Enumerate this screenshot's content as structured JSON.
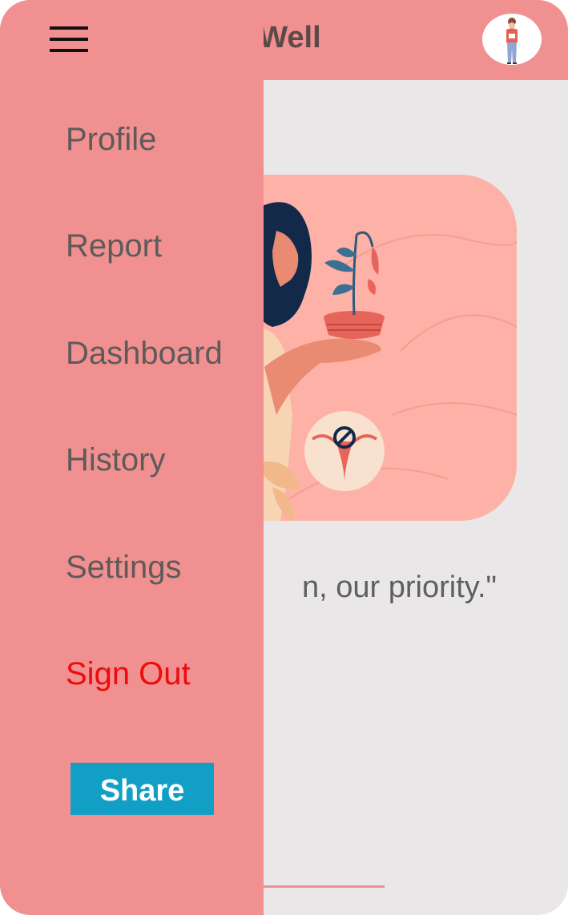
{
  "header": {
    "title": "nWell",
    "avatar_icon": "user-avatar-icon",
    "background": "#f09090"
  },
  "main": {
    "tagline": "n, our priority.\"",
    "hero_illustration": "woman-holding-wilting-plant-illustration",
    "hero_background": "#feb1a6"
  },
  "drawer": {
    "menu_icon": "hamburger-menu-icon",
    "items": [
      {
        "label": "Profile"
      },
      {
        "label": "Report"
      },
      {
        "label": "Dashboard"
      },
      {
        "label": "History"
      },
      {
        "label": "Settings"
      }
    ],
    "sign_out_label": "Sign Out",
    "share_label": "Share",
    "colors": {
      "background": "#f09090",
      "text": "#5f5a5a",
      "sign_out": "#ee0b0b",
      "share_button": "#129fc6"
    }
  }
}
